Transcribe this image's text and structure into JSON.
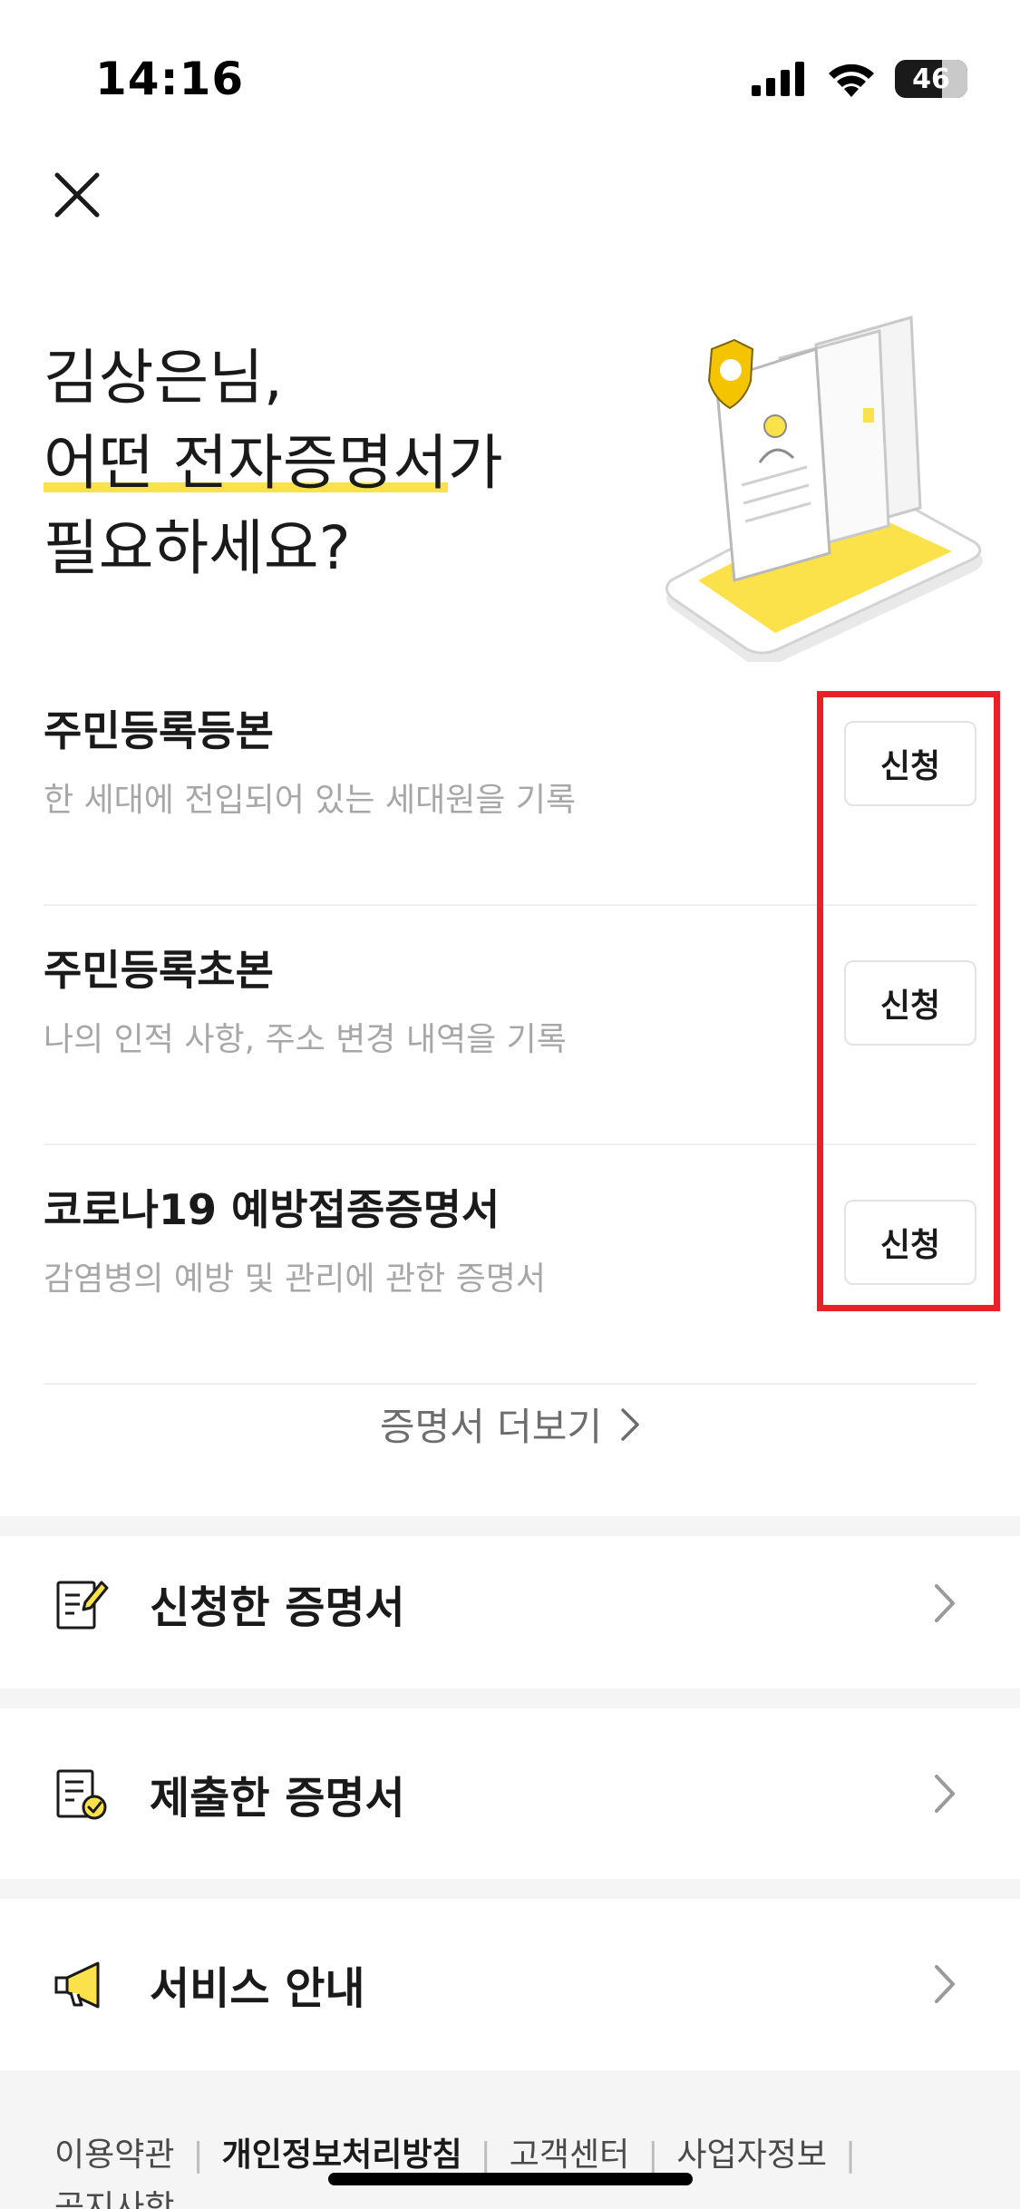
{
  "status_bar": {
    "time": "14:16",
    "battery": "46"
  },
  "hero": {
    "line1": "김상은님,",
    "line2_highlight": "어떤 전자증명서",
    "line2_rest": "가",
    "line3": "필요하세요?"
  },
  "certificates": [
    {
      "name": "주민등록등본",
      "description": "한 세대에 전입되어 있는 세대원을 기록",
      "button": "신청"
    },
    {
      "name": "주민등록초본",
      "description": "나의 인적 사항, 주소 변경 내역을 기록",
      "button": "신청"
    },
    {
      "name": "코로나19 예방접종증명서",
      "description": "감염병의 예방 및 관리에 관한 증명서",
      "button": "신청"
    }
  ],
  "more_link": "증명서 더보기",
  "menu": [
    {
      "label": "신청한 증명서",
      "icon": "edit-document-icon"
    },
    {
      "label": "제출한 증명서",
      "icon": "submitted-document-icon"
    },
    {
      "label": "서비스 안내",
      "icon": "megaphone-icon"
    }
  ],
  "footer": {
    "links": [
      "이용약관",
      "개인정보처리방침",
      "고객센터",
      "사업자정보",
      "공지사항"
    ],
    "separator": "|"
  },
  "colors": {
    "accent_yellow": "#fbe14a",
    "highlight_red": "#e8202a",
    "muted_text": "#a7a7a7"
  }
}
